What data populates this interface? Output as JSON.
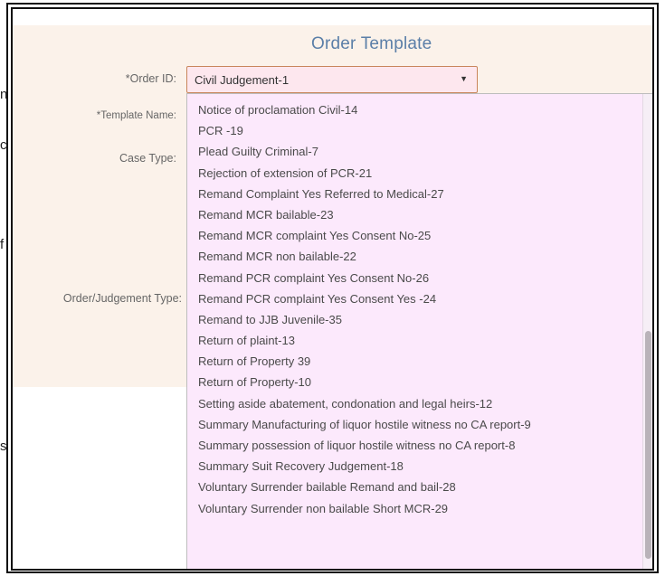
{
  "form": {
    "title": "Order Template",
    "labels": {
      "order_id": "*Order ID:",
      "template_name": "*Template Name:",
      "case_type": "Case Type:",
      "order_judgement_type": "Order/Judgement Type:"
    },
    "order_id_value": "Civil Judgement-1"
  },
  "dropdown": {
    "items": [
      "Notice of proclamation Civil-14",
      "PCR -19",
      "Plead Guilty Criminal-7",
      "Rejection of extension of PCR-21",
      "Remand Complaint Yes Referred to Medical-27",
      "Remand MCR bailable-23",
      "Remand MCR complaint Yes Consent No-25",
      "Remand MCR non bailable-22",
      "Remand PCR complaint Yes Consent No-26",
      "Remand PCR complaint Yes Consent Yes -24",
      "Remand to JJB Juvenile-35",
      "Return of plaint-13",
      "Return of Property 39",
      "Return of Property-10",
      "Setting aside abatement, condonation and legal heirs-12",
      "Summary Manufacturing of liquor hostile witness no CA report-9",
      "Summary possession of liquor hostile witness no CA report-8",
      "Summary Suit Recovery Judgement-18",
      "Voluntary Surrender bailable Remand and bail-28",
      "Voluntary Surrender non bailable Short MCR-29"
    ]
  },
  "edge_chars": [
    "n",
    "c",
    "f",
    "s"
  ]
}
